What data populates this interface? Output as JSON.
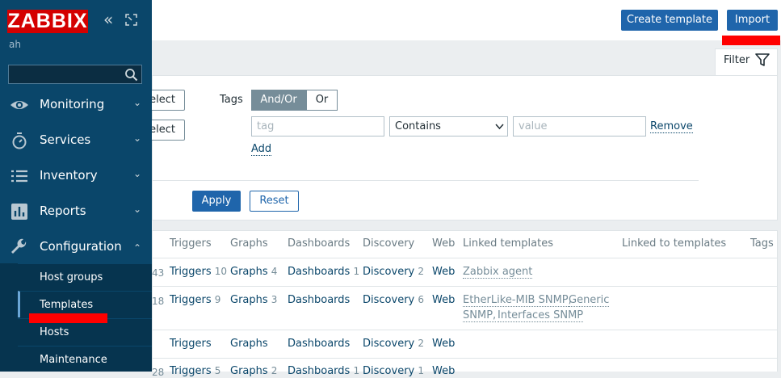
{
  "header": {
    "create_template_label": "Create template",
    "import_label": "Import"
  },
  "sidebar": {
    "logo": "ZABBIX",
    "user": "ah",
    "search_placeholder": "",
    "menu": [
      {
        "label": "Monitoring",
        "icon": "eye-icon"
      },
      {
        "label": "Services",
        "icon": "stopwatch-icon"
      },
      {
        "label": "Inventory",
        "icon": "list-icon"
      },
      {
        "label": "Reports",
        "icon": "bar-chart-icon"
      },
      {
        "label": "Configuration",
        "icon": "wrench-icon"
      }
    ],
    "submenu": [
      "Host groups",
      "Templates",
      "Hosts",
      "Maintenance"
    ],
    "accent": "#d40000"
  },
  "filter": {
    "tab_label": "Filter",
    "select_1": "elect",
    "select_2": "elect",
    "tags_label": "Tags",
    "and_or": "And/Or",
    "or": "Or",
    "tag_placeholder": "tag",
    "operator": "Contains",
    "value_placeholder": "value",
    "remove": "Remove",
    "add": "Add",
    "apply": "Apply",
    "reset": "Reset"
  },
  "table": {
    "columns": [
      "Triggers",
      "Graphs",
      "Dashboards",
      "Discovery",
      "Web",
      "Linked templates",
      "Linked to templates",
      "Tags"
    ],
    "rows": [
      {
        "prev_count": "43",
        "triggers": "Triggers",
        "triggers_count": "10",
        "graphs": "Graphs",
        "graphs_count": "4",
        "dashboards": "Dashboards",
        "dashboards_count": "1",
        "discovery": "Discovery",
        "discovery_count": "2",
        "web": "Web",
        "linked": [
          "Zabbix agent"
        ]
      },
      {
        "prev_count": "18",
        "triggers": "Triggers",
        "triggers_count": "9",
        "graphs": "Graphs",
        "graphs_count": "3",
        "dashboards": "Dashboards",
        "dashboards_count": "",
        "discovery": "Discovery",
        "discovery_count": "6",
        "web": "Web",
        "linked": [
          "EtherLike-MIB SNMP,",
          "Generic",
          "SNMP,",
          "Interfaces SNMP"
        ]
      },
      {
        "prev_count": "",
        "triggers": "Triggers",
        "triggers_count": "",
        "graphs": "Graphs",
        "graphs_count": "",
        "dashboards": "Dashboards",
        "dashboards_count": "",
        "discovery": "Discovery",
        "discovery_count": "2",
        "web": "Web",
        "linked": []
      },
      {
        "prev_count": "28",
        "triggers": "Triggers",
        "triggers_count": "5",
        "graphs": "Graphs",
        "graphs_count": "2",
        "dashboards": "Dashboards",
        "dashboards_count": "1",
        "discovery": "Discovery",
        "discovery_count": "1",
        "web": "Web",
        "linked": []
      }
    ]
  }
}
